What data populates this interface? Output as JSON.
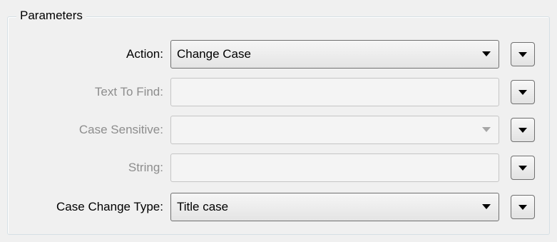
{
  "group": {
    "title": "Parameters"
  },
  "rows": [
    {
      "label": "Action:",
      "value": "Change Case",
      "enabled": true,
      "control": "dropdown"
    },
    {
      "label": "Text To Find:",
      "value": "",
      "enabled": false,
      "control": "text"
    },
    {
      "label": "Case Sensitive:",
      "value": "",
      "enabled": false,
      "control": "dropdown"
    },
    {
      "label": "String:",
      "value": "",
      "enabled": false,
      "control": "text"
    },
    {
      "label": "Case Change Type:",
      "value": "Title case",
      "enabled": true,
      "control": "dropdown"
    }
  ],
  "icons": {
    "dropdown": "chevron-down-icon",
    "side_button": "chevron-down-icon"
  },
  "colors": {
    "background": "#f0f0f0",
    "disabled_text": "#8d8d8d",
    "border": "#707070"
  }
}
